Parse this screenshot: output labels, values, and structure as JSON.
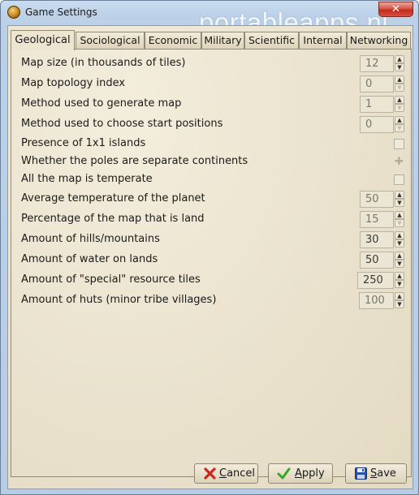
{
  "window": {
    "title": "Game Settings",
    "watermark": "portableapps.nl",
    "close_symbol": "✕"
  },
  "tabs": [
    {
      "label": "Geological",
      "active": true
    },
    {
      "label": "Sociological",
      "active": false
    },
    {
      "label": "Economic",
      "active": false
    },
    {
      "label": "Military",
      "active": false
    },
    {
      "label": "Scientific",
      "active": false
    },
    {
      "label": "Internal",
      "active": false
    },
    {
      "label": "Networking",
      "active": false
    }
  ],
  "settings": [
    {
      "label": "Map size (in thousands of tiles)",
      "type": "spin",
      "value": "12"
    },
    {
      "label": "Map topology index",
      "type": "spin",
      "value": "0"
    },
    {
      "label": "Method used to generate map",
      "type": "spin",
      "value": "1"
    },
    {
      "label": "Method used to choose start positions",
      "type": "spin",
      "value": "0"
    },
    {
      "label": "Presence of 1x1 islands",
      "type": "checkbox",
      "checked": false
    },
    {
      "label": "Whether the poles are separate continents",
      "type": "checkbox",
      "checked": true
    },
    {
      "label": "All the map is temperate",
      "type": "checkbox",
      "checked": false
    },
    {
      "label": "Average temperature of the planet",
      "type": "spin",
      "value": "50"
    },
    {
      "label": "Percentage of the map that is land",
      "type": "spin",
      "value": "15"
    },
    {
      "label": "Amount of hills/mountains",
      "type": "spin",
      "value": "30"
    },
    {
      "label": "Amount of water on lands",
      "type": "spin",
      "value": "50"
    },
    {
      "label": "Amount of \"special\" resource tiles",
      "type": "spin",
      "value": "250"
    },
    {
      "label": "Amount of huts (minor tribe villages)",
      "type": "spin",
      "value": "100"
    }
  ],
  "buttons": {
    "cancel": {
      "prefix": "",
      "mnemonic": "C",
      "rest": "ancel"
    },
    "apply": {
      "prefix": "",
      "mnemonic": "A",
      "rest": "pply"
    },
    "save": {
      "prefix": "",
      "mnemonic": "S",
      "rest": "ave"
    }
  },
  "colors": {
    "panel_bg": "#eee7d4",
    "close_red": "#c42b1c",
    "cancel_icon": "#d4251c",
    "apply_icon": "#3aa828",
    "save_icon": "#2a4fa8"
  }
}
